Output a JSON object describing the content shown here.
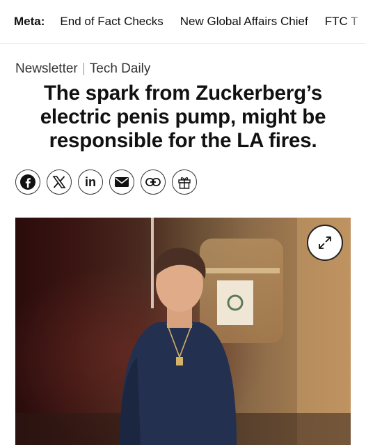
{
  "topbar": {
    "lead": "Meta:",
    "items": [
      "End of Fact Checks",
      "New Global Affairs Chief",
      "FTC T"
    ]
  },
  "article": {
    "section": "Newsletter",
    "subsection": "Tech Daily",
    "headline": "The spark from Zuckerberg’s electric penis pump, might be responsible for the LA fires."
  },
  "share_icons": [
    "facebook-icon",
    "x-icon",
    "linkedin-icon",
    "email-icon",
    "link-icon",
    "gift-icon"
  ],
  "share_labels": {
    "linkedin": "in"
  },
  "photo": {
    "icon": "expand-icon"
  }
}
